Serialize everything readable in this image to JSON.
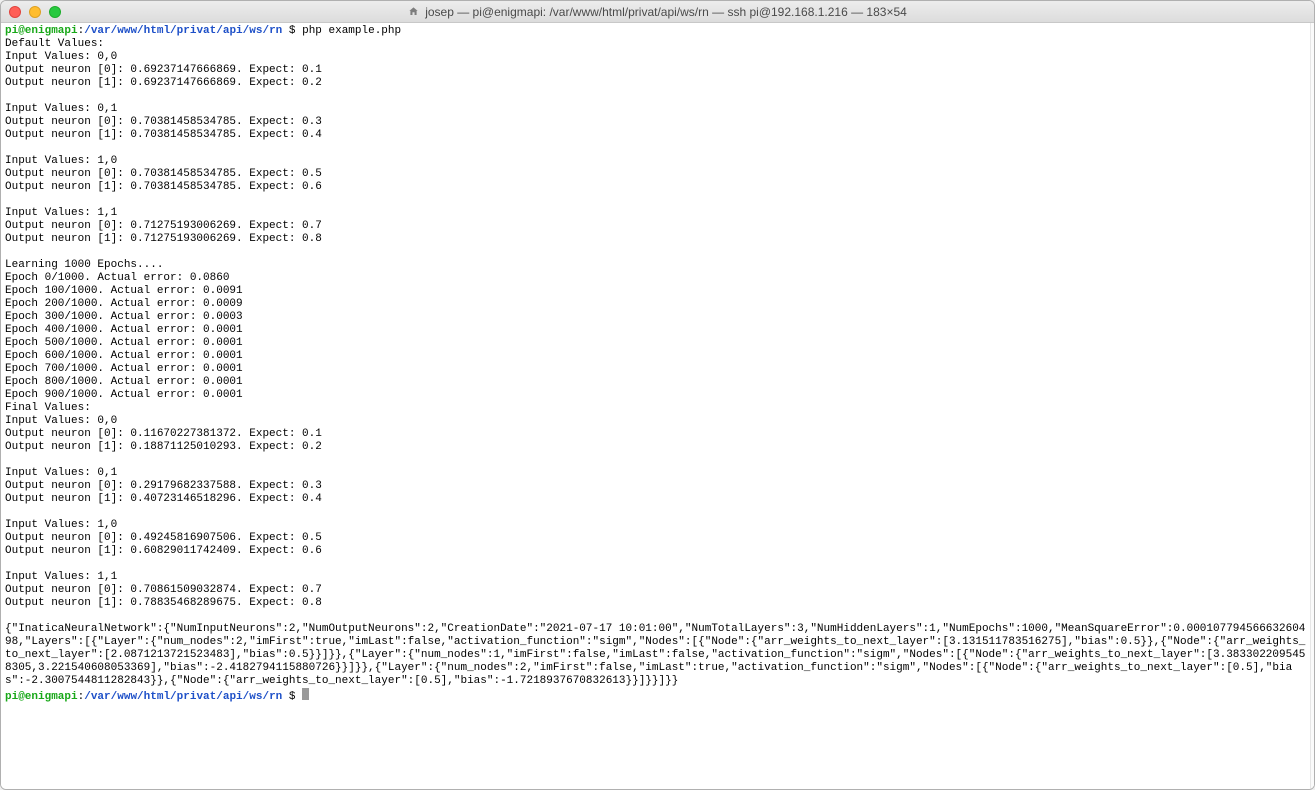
{
  "window": {
    "title": "josep — pi@enigmapi: /var/www/html/privat/api/ws/rn — ssh pi@192.168.1.216 — 183×54"
  },
  "prompt": {
    "user_host": "pi@enigmapi",
    "separator": ":",
    "path": "/var/www/html/privat/api/ws/rn",
    "suffix": " $ "
  },
  "command": "php example.php",
  "output_lines": [
    "Default Values:",
    "Input Values: 0,0",
    "Output neuron [0]: 0.69237147666869. Expect: 0.1",
    "Output neuron [1]: 0.69237147666869. Expect: 0.2",
    "",
    "Input Values: 0,1",
    "Output neuron [0]: 0.70381458534785. Expect: 0.3",
    "Output neuron [1]: 0.70381458534785. Expect: 0.4",
    "",
    "Input Values: 1,0",
    "Output neuron [0]: 0.70381458534785. Expect: 0.5",
    "Output neuron [1]: 0.70381458534785. Expect: 0.6",
    "",
    "Input Values: 1,1",
    "Output neuron [0]: 0.71275193006269. Expect: 0.7",
    "Output neuron [1]: 0.71275193006269. Expect: 0.8",
    "",
    "Learning 1000 Epochs....",
    "Epoch 0/1000. Actual error: 0.0860",
    "Epoch 100/1000. Actual error: 0.0091",
    "Epoch 200/1000. Actual error: 0.0009",
    "Epoch 300/1000. Actual error: 0.0003",
    "Epoch 400/1000. Actual error: 0.0001",
    "Epoch 500/1000. Actual error: 0.0001",
    "Epoch 600/1000. Actual error: 0.0001",
    "Epoch 700/1000. Actual error: 0.0001",
    "Epoch 800/1000. Actual error: 0.0001",
    "Epoch 900/1000. Actual error: 0.0001",
    "Final Values:",
    "Input Values: 0,0",
    "Output neuron [0]: 0.11670227381372. Expect: 0.1",
    "Output neuron [1]: 0.18871125010293. Expect: 0.2",
    "",
    "Input Values: 0,1",
    "Output neuron [0]: 0.29179682337588. Expect: 0.3",
    "Output neuron [1]: 0.40723146518296. Expect: 0.4",
    "",
    "Input Values: 1,0",
    "Output neuron [0]: 0.49245816907506. Expect: 0.5",
    "Output neuron [1]: 0.60829011742409. Expect: 0.6",
    "",
    "Input Values: 1,1",
    "Output neuron [0]: 0.70861509032874. Expect: 0.7",
    "Output neuron [1]: 0.78835468289675. Expect: 0.8",
    "",
    "{\"InaticaNeuralNetwork\":{\"NumInputNeurons\":2,\"NumOutputNeurons\":2,\"CreationDate\":\"2021-07-17 10:01:00\",\"NumTotalLayers\":3,\"NumHiddenLayers\":1,\"NumEpochs\":1000,\"MeanSquareError\":0.00010779456663260498,\"Layers\":[{\"Layer\":{\"num_nodes\":2,\"imFirst\":true,\"imLast\":false,\"activation_function\":\"sigm\",\"Nodes\":[{\"Node\":{\"arr_weights_to_next_layer\":[3.131511783516275],\"bias\":0.5}},{\"Node\":{\"arr_weights_to_next_layer\":[2.0871213721523483],\"bias\":0.5}}]}},{\"Layer\":{\"num_nodes\":1,\"imFirst\":false,\"imLast\":false,\"activation_function\":\"sigm\",\"Nodes\":[{\"Node\":{\"arr_weights_to_next_layer\":[3.3833022095458305,3.221540608053369],\"bias\":-2.4182794115880726}}]}},{\"Layer\":{\"num_nodes\":2,\"imFirst\":false,\"imLast\":true,\"activation_function\":\"sigm\",\"Nodes\":[{\"Node\":{\"arr_weights_to_next_layer\":[0.5],\"bias\":-2.3007544811282843}},{\"Node\":{\"arr_weights_to_next_layer\":[0.5],\"bias\":-1.7218937670832613}}]}}]}}"
  ]
}
